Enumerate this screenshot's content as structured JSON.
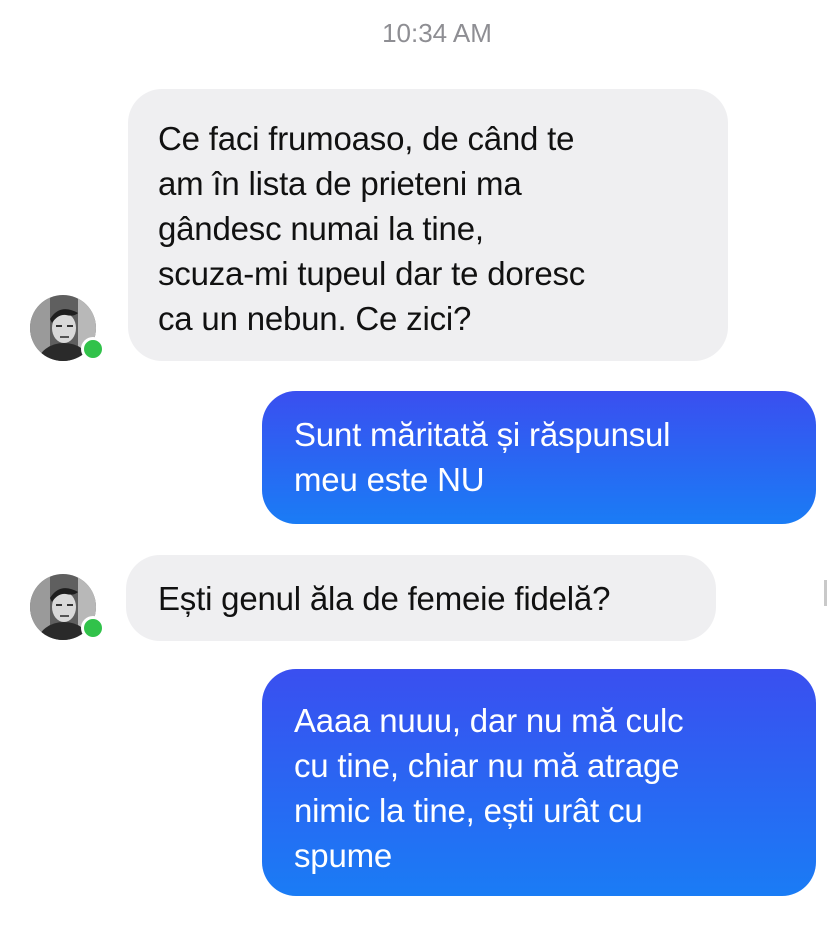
{
  "conversation": {
    "timestamp": "10:34 AM",
    "messages": [
      {
        "sender": "contact",
        "lines": [
          "Ce faci frumoaso, de când te",
          "am în lista de prieteni ma",
          "gândesc numai la tine,",
          "scuza-mi tupeul dar te doresc",
          "ca un nebun. Ce zici?"
        ]
      },
      {
        "sender": "me",
        "lines": [
          "Sunt măritată și răspunsul",
          "meu este NU"
        ]
      },
      {
        "sender": "contact",
        "lines": [
          "Ești genul ăla de femeie fidelă?"
        ]
      },
      {
        "sender": "me",
        "lines": [
          "Aaaa nuuu, dar nu mă culc",
          "cu tine, chiar nu mă atrage",
          "nimic la tine, ești urât cu",
          "spume"
        ]
      }
    ]
  },
  "contact": {
    "avatar_icon": "profile-photo-icon",
    "status_icon": "online-status-icon",
    "status_color": "#31c24a"
  },
  "colors": {
    "incoming_bubble": "#efeff1",
    "outgoing_gradient_top": "#3a4ff0",
    "outgoing_gradient_bottom": "#1a7cf5",
    "timestamp_text": "#8e8e93"
  }
}
